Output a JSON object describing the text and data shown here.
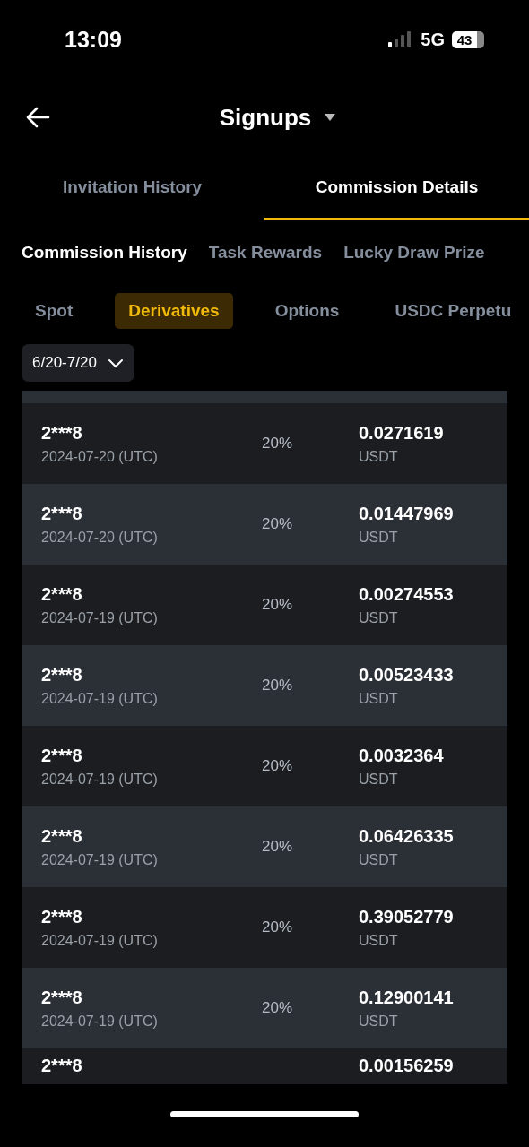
{
  "status_bar": {
    "time": "13:09",
    "network": "5G",
    "battery": "43"
  },
  "header": {
    "title": "Signups"
  },
  "tabs": [
    {
      "label": "Invitation History",
      "selected": false
    },
    {
      "label": "Commission Details",
      "selected": true
    }
  ],
  "sub_tabs": [
    {
      "label": "Commission History",
      "selected": true
    },
    {
      "label": "Task Rewards",
      "selected": false
    },
    {
      "label": "Lucky Draw Prize",
      "selected": false
    }
  ],
  "product_tabs": [
    {
      "label": "Spot",
      "selected": false
    },
    {
      "label": "Derivatives",
      "selected": true
    },
    {
      "label": "Options",
      "selected": false
    },
    {
      "label": "USDC Perpetu",
      "selected": false
    }
  ],
  "date_filter": {
    "value": "6/20-7/20"
  },
  "records": [
    {
      "user": "2***8",
      "date": "2024-07-20 (UTC)",
      "rate": "20%",
      "amount": "0.0271619",
      "currency": "USDT"
    },
    {
      "user": "2***8",
      "date": "2024-07-20 (UTC)",
      "rate": "20%",
      "amount": "0.01447969",
      "currency": "USDT"
    },
    {
      "user": "2***8",
      "date": "2024-07-19 (UTC)",
      "rate": "20%",
      "amount": "0.00274553",
      "currency": "USDT"
    },
    {
      "user": "2***8",
      "date": "2024-07-19 (UTC)",
      "rate": "20%",
      "amount": "0.00523433",
      "currency": "USDT"
    },
    {
      "user": "2***8",
      "date": "2024-07-19 (UTC)",
      "rate": "20%",
      "amount": "0.0032364",
      "currency": "USDT"
    },
    {
      "user": "2***8",
      "date": "2024-07-19 (UTC)",
      "rate": "20%",
      "amount": "0.06426335",
      "currency": "USDT"
    },
    {
      "user": "2***8",
      "date": "2024-07-19 (UTC)",
      "rate": "20%",
      "amount": "0.39052779",
      "currency": "USDT"
    },
    {
      "user": "2***8",
      "date": "2024-07-19 (UTC)",
      "rate": "20%",
      "amount": "0.12900141",
      "currency": "USDT"
    },
    {
      "user": "2***8",
      "amount": "0.00156259"
    }
  ]
}
